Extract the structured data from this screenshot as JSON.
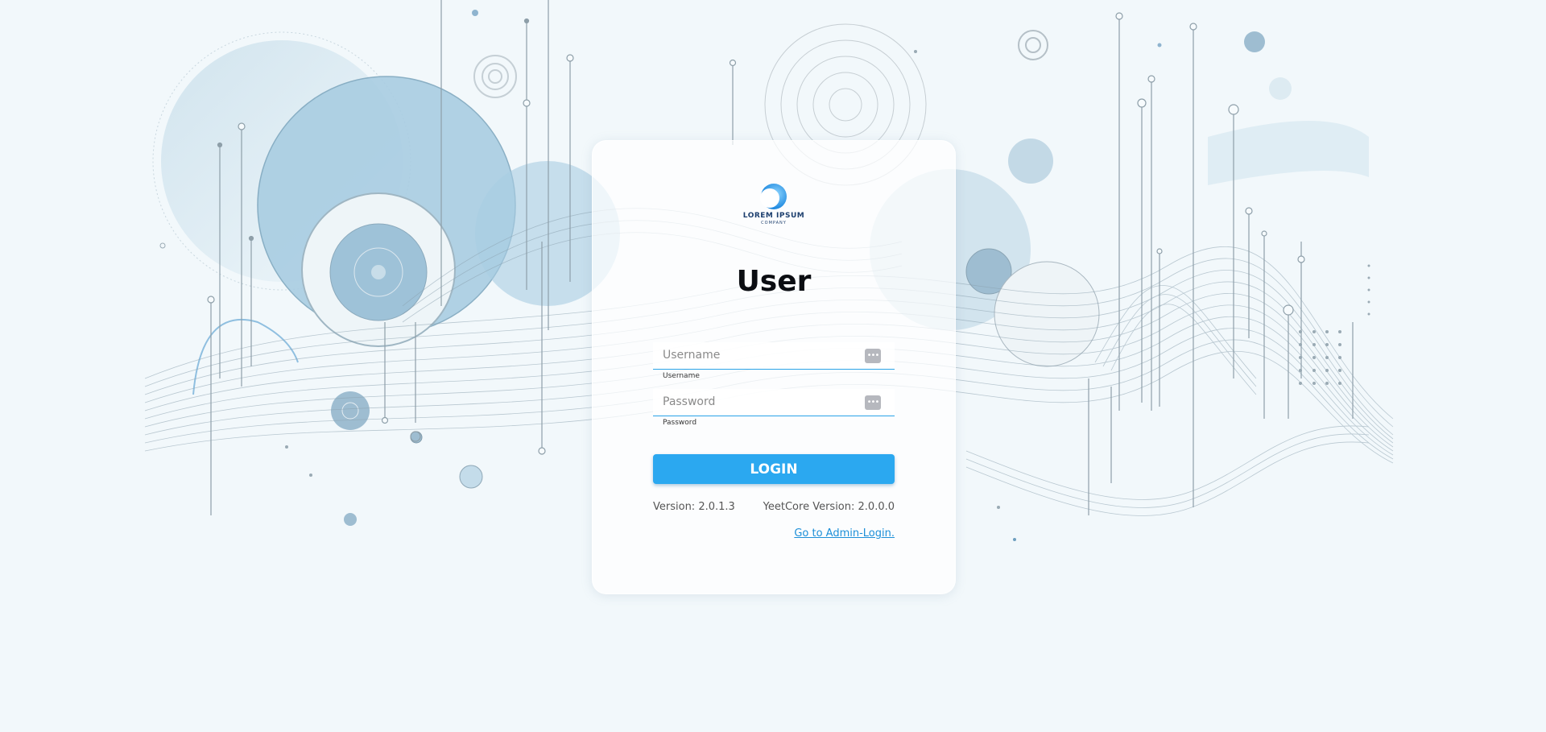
{
  "brand": {
    "name": "LOREM IPSUM",
    "tagline": "COMPANY",
    "logo_icon": "crescent-logo-icon"
  },
  "login": {
    "title": "User",
    "username": {
      "value": "",
      "placeholder": "Username",
      "hint": "Username",
      "icon": "password-manager-key-icon"
    },
    "password": {
      "value": "",
      "placeholder": "Password",
      "hint": "Password",
      "icon": "password-manager-key-icon"
    },
    "button_label": "LOGIN",
    "version": "Version: 2.0.1.3",
    "core_version": "YeetCore Version: 2.0.0.0",
    "admin_link": "Go to Admin-Login."
  },
  "colors": {
    "accent": "#2ba8f0",
    "link": "#1c8fd8",
    "background": "#f1f8fb"
  }
}
